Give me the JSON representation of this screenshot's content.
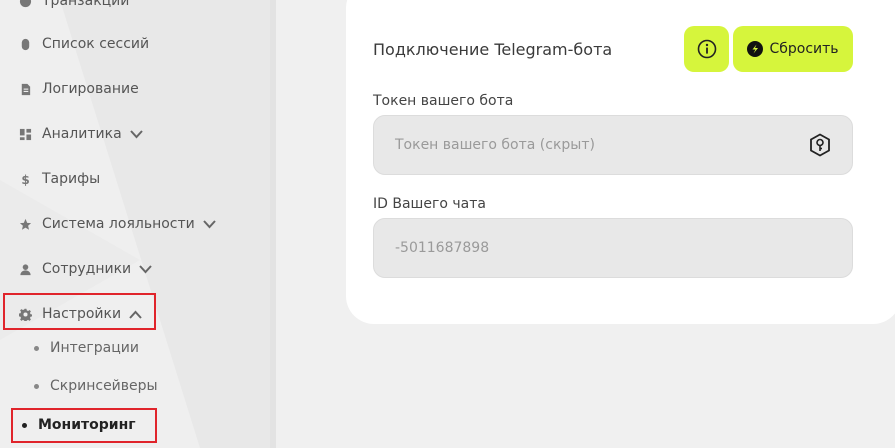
{
  "sidebar": {
    "items": [
      {
        "label": "Транзакции",
        "icon": "transactions-icon"
      },
      {
        "label": "Список сессий",
        "icon": "mouse-icon"
      },
      {
        "label": "Логирование",
        "icon": "document-icon"
      },
      {
        "label": "Аналитика",
        "icon": "dashboard-icon",
        "expandable": true
      },
      {
        "label": "Тарифы",
        "icon": "dollar-icon"
      },
      {
        "label": "Система лояльности",
        "icon": "star-icon",
        "expandable": true
      },
      {
        "label": "Сотрудники",
        "icon": "user-icon",
        "expandable": true
      },
      {
        "label": "Настройки",
        "icon": "gear-icon",
        "expanded": true
      }
    ],
    "subitems": [
      {
        "label": "Интеграции"
      },
      {
        "label": "Скринсейверы"
      },
      {
        "label": "Мониторинг",
        "active": true
      }
    ]
  },
  "card": {
    "title": "Подключение Telegram-бота",
    "reset_label": "Сбросить",
    "token_label": "Токен вашего бота",
    "token_placeholder": "Токен вашего бота (скрыт)",
    "chat_label": "ID Вашего чата",
    "chat_value": "-5011687898"
  },
  "colors": {
    "accent": "#d6f53c",
    "highlight": "#e0242b"
  }
}
